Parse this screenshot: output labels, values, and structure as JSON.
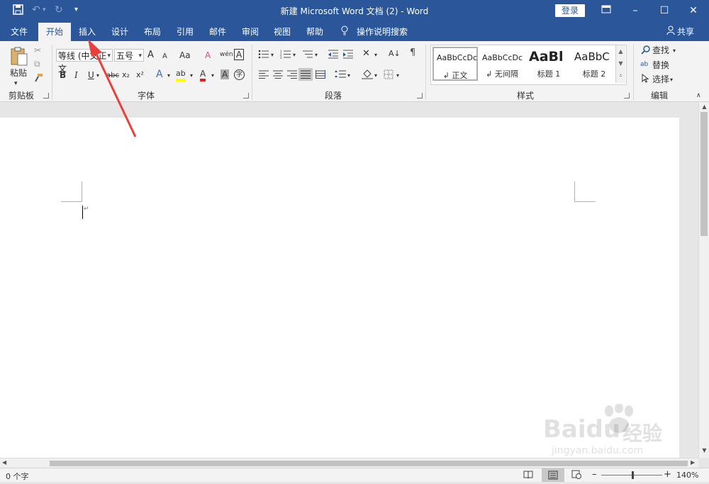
{
  "window": {
    "title": "新建 Microsoft Word 文档 (2)  -  Word",
    "login_label": "登录"
  },
  "tabs": [
    "文件",
    "开始",
    "插入",
    "设计",
    "布局",
    "引用",
    "邮件",
    "审阅",
    "视图",
    "帮助"
  ],
  "tell_me": "操作说明搜索",
  "share_label": "共享",
  "ribbon": {
    "clipboard": {
      "label": "剪贴板",
      "paste_label": "粘贴"
    },
    "font": {
      "label": "字体",
      "font_name": "等线 (中文正文",
      "font_size": "五号",
      "grow": "A",
      "shrink": "A",
      "case": "Aa",
      "clear": "A",
      "phonetic": "wén",
      "border_char": "A",
      "bold": "B",
      "italic": "I",
      "underline": "U",
      "strike": "abc",
      "subscript": "x₂",
      "superscript": "x²",
      "effects": "A",
      "highlight": "ab",
      "font_color": "A",
      "shading": "A",
      "enclose": "字"
    },
    "paragraph": {
      "label": "段落"
    },
    "styles": {
      "label": "样式",
      "items": [
        {
          "sample": "AaBbCcDc",
          "name": "↲ 正文"
        },
        {
          "sample": "AaBbCcDc",
          "name": "↲ 无间隔"
        },
        {
          "sample": "AaBl",
          "name": "标题 1"
        },
        {
          "sample": "AaBbC",
          "name": "标题 2"
        }
      ]
    },
    "editing": {
      "label": "编辑",
      "find": "查找",
      "replace": "替换",
      "select": "选择"
    }
  },
  "document": {
    "paragraph_mark": "↵"
  },
  "status": {
    "word_count": "0 个字",
    "zoom": "140%"
  },
  "watermark": {
    "brand": "Baidu",
    "brand_cn": "经验",
    "url": "jingyan.baidu.com"
  },
  "colors": {
    "title_blue": "#2b579a",
    "annotation_arrow": "#e8403a",
    "highlight_yellow": "#ffff00",
    "font_red": "#e02020"
  }
}
